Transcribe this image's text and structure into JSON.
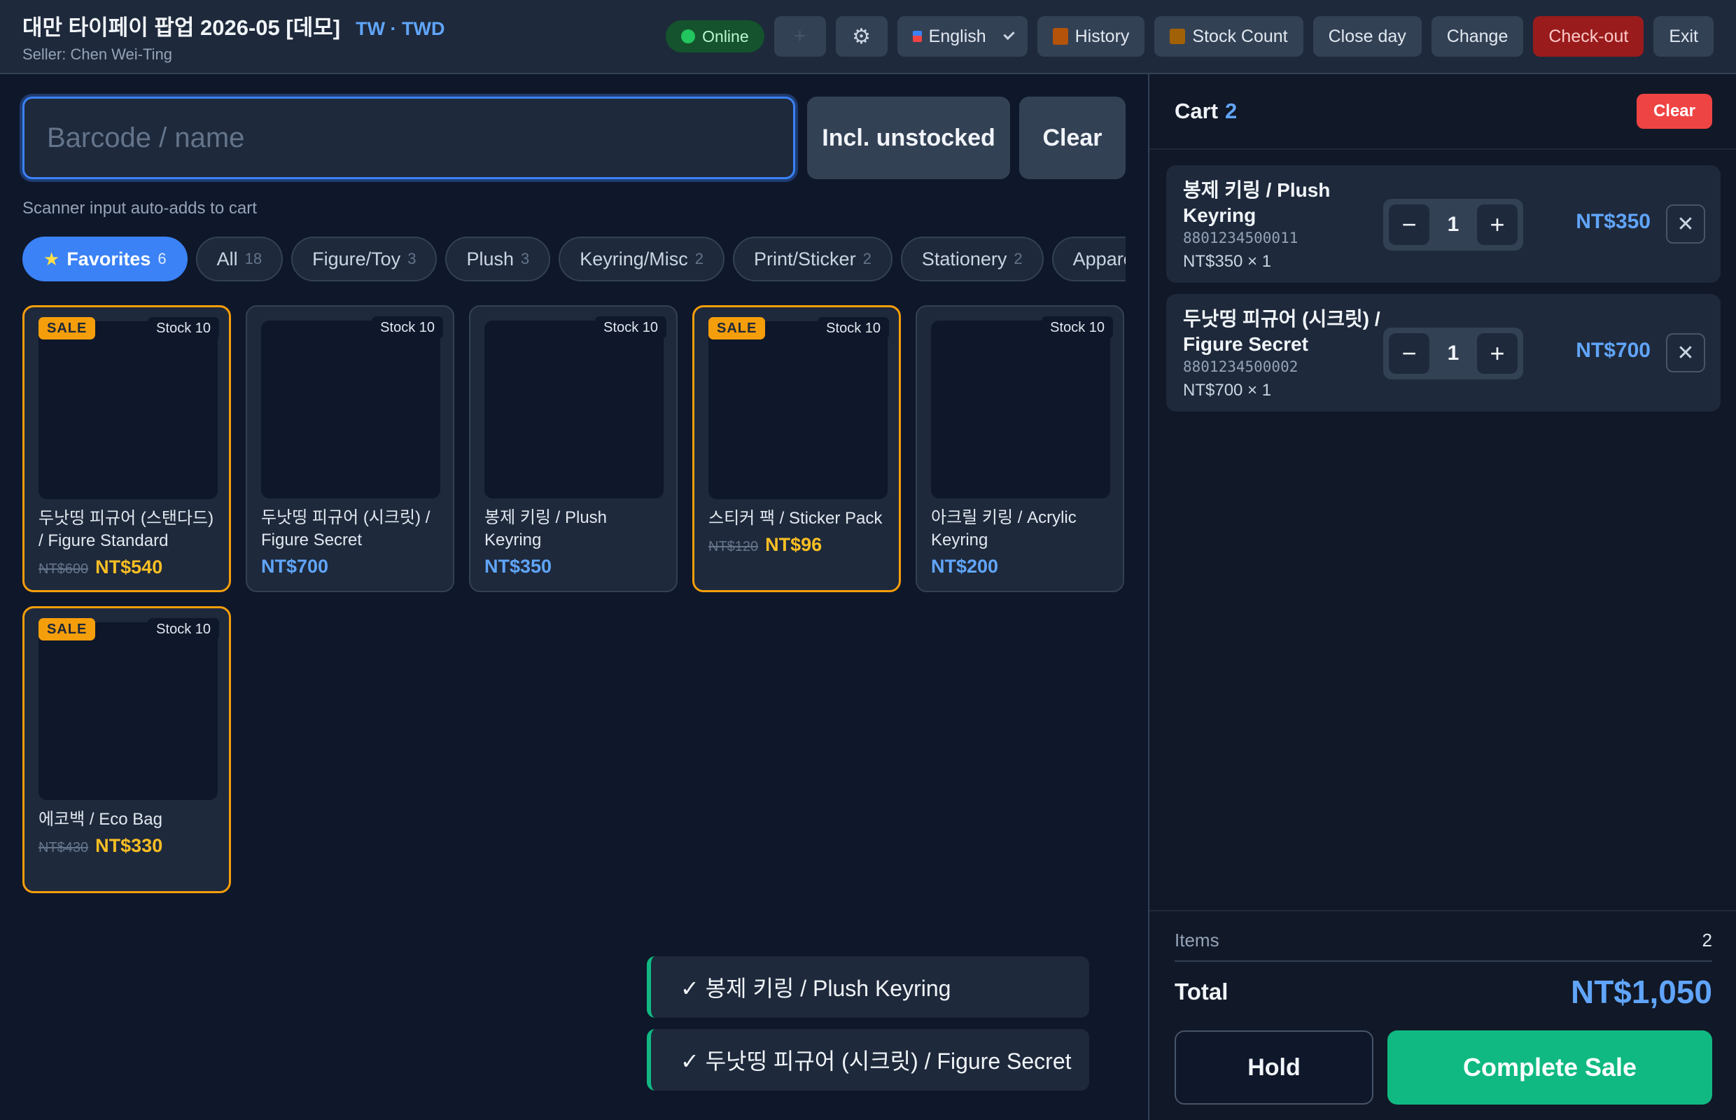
{
  "header": {
    "title": "대만 타이페이 팝업 2026-05 [데모]",
    "currency": "TW · TWD",
    "seller": "Seller: Chen Wei-Ting",
    "online_label": "Online",
    "language_label": "English",
    "history_label": "History",
    "stock_count_label": "Stock Count",
    "close_day_label": "Close day",
    "change_label": "Change",
    "checkout_label": "Check-out",
    "exit_label": "Exit"
  },
  "search": {
    "placeholder": "Barcode / name",
    "incl_unstocked_label": "Incl. unstocked",
    "clear_label": "Clear",
    "hint": "Scanner input auto-adds to cart"
  },
  "categories": [
    {
      "label": "Favorites",
      "count": "6"
    },
    {
      "label": "All",
      "count": "18"
    },
    {
      "label": "Figure/Toy",
      "count": "3"
    },
    {
      "label": "Plush",
      "count": "3"
    },
    {
      "label": "Keyring/Misc",
      "count": "2"
    },
    {
      "label": "Print/Sticker",
      "count": "2"
    },
    {
      "label": "Stationery",
      "count": "2"
    },
    {
      "label": "Apparel",
      "count": ""
    }
  ],
  "products": [
    {
      "name": "두낫띵 피규어 (스탠다드) / Figure Standard",
      "stock": "Stock 10",
      "sale_badge": "SALE",
      "old_price": "NT$600",
      "price": "NT$540"
    },
    {
      "name": "두낫띵 피규어 (시크릿) / Figure Secret",
      "stock": "Stock 10",
      "sale_badge": "",
      "old_price": "",
      "price": "NT$700"
    },
    {
      "name": "봉제 키링 / Plush Keyring",
      "stock": "Stock 10",
      "sale_badge": "",
      "old_price": "",
      "price": "NT$350"
    },
    {
      "name": "스티커 팩 / Sticker Pack",
      "stock": "Stock 10",
      "sale_badge": "SALE",
      "old_price": "NT$120",
      "price": "NT$96"
    },
    {
      "name": "아크릴 키링 / Acrylic Keyring",
      "stock": "Stock 10",
      "sale_badge": "",
      "old_price": "",
      "price": "NT$200"
    },
    {
      "name": "에코백 / Eco Bag",
      "stock": "Stock 10",
      "sale_badge": "SALE",
      "old_price": "NT$430",
      "price": "NT$330"
    }
  ],
  "toasts": [
    "✓ 봉제 키링 / Plush Keyring",
    "✓ 두낫띵 피규어 (시크릿) / Figure Secret"
  ],
  "cart": {
    "title": "Cart",
    "count": "2",
    "clear_label": "Clear",
    "items": [
      {
        "name": "봉제 키링 / Plush Keyring",
        "barcode": "8801234500011",
        "unit": "NT$350 × 1",
        "qty": "1",
        "total": "NT$350"
      },
      {
        "name": "두낫띵 피규어 (시크릿) / Figure Secret",
        "barcode": "8801234500002",
        "unit": "NT$700 × 1",
        "qty": "1",
        "total": "NT$700"
      }
    ],
    "items_label": "Items",
    "items_value": "2",
    "total_label": "Total",
    "total_value": "NT$1,050",
    "hold_label": "Hold",
    "complete_label": "Complete Sale"
  },
  "colors": {
    "accent": "#3b82f6",
    "sale": "#f59e0b",
    "success": "#10b981",
    "danger": "#ef4444"
  }
}
